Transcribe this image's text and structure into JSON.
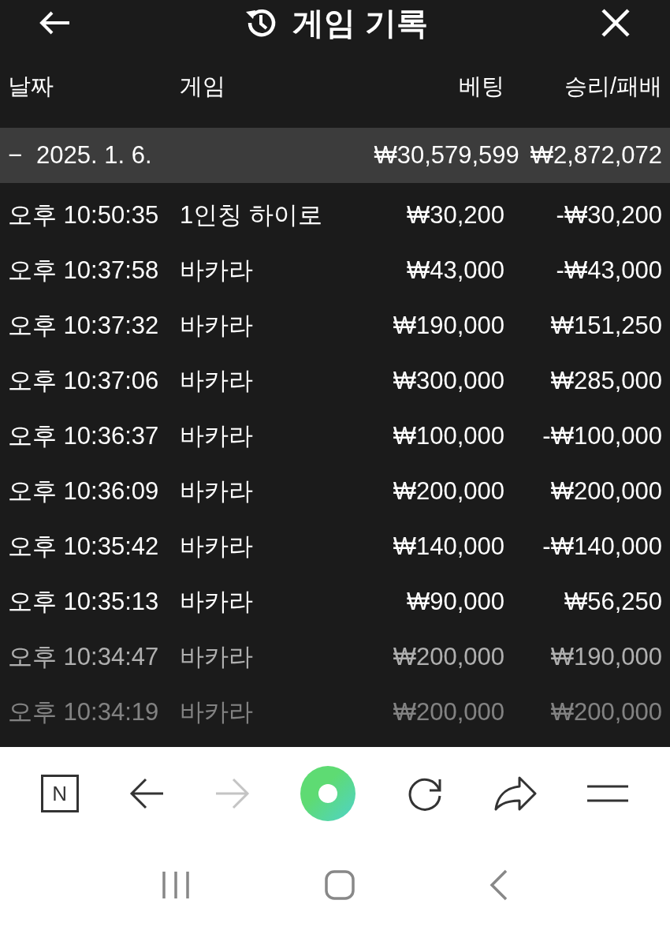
{
  "header": {
    "title": "게임 기록"
  },
  "columns": [
    "날짜",
    "게임",
    "베팅",
    "승리/패배"
  ],
  "group": {
    "toggle": "−",
    "date": "2025. 1. 6.",
    "bet": "₩30,579,599",
    "result": "₩2,872,072",
    "expanded": true
  },
  "rows": [
    {
      "time": "오후 10:50:35",
      "game": "1인칭 하이로",
      "bet": "₩30,200",
      "result": "-₩30,200"
    },
    {
      "time": "오후 10:37:58",
      "game": "바카라",
      "bet": "₩43,000",
      "result": "-₩43,000"
    },
    {
      "time": "오후 10:37:32",
      "game": "바카라",
      "bet": "₩190,000",
      "result": "₩151,250"
    },
    {
      "time": "오후 10:37:06",
      "game": "바카라",
      "bet": "₩300,000",
      "result": "₩285,000"
    },
    {
      "time": "오후 10:36:37",
      "game": "바카라",
      "bet": "₩100,000",
      "result": "-₩100,000"
    },
    {
      "time": "오후 10:36:09",
      "game": "바카라",
      "bet": "₩200,000",
      "result": "₩200,000"
    },
    {
      "time": "오후 10:35:42",
      "game": "바카라",
      "bet": "₩140,000",
      "result": "-₩140,000"
    },
    {
      "time": "오후 10:35:13",
      "game": "바카라",
      "bet": "₩90,000",
      "result": "₩56,250"
    },
    {
      "time": "오후 10:34:47",
      "game": "바카라",
      "bet": "₩200,000",
      "result": "₩190,000"
    },
    {
      "time": "오후 10:34:19",
      "game": "바카라",
      "bet": "₩200,000",
      "result": "₩200,000"
    }
  ],
  "browser_toolbar": {
    "logo": "N",
    "forward_disabled": true
  }
}
